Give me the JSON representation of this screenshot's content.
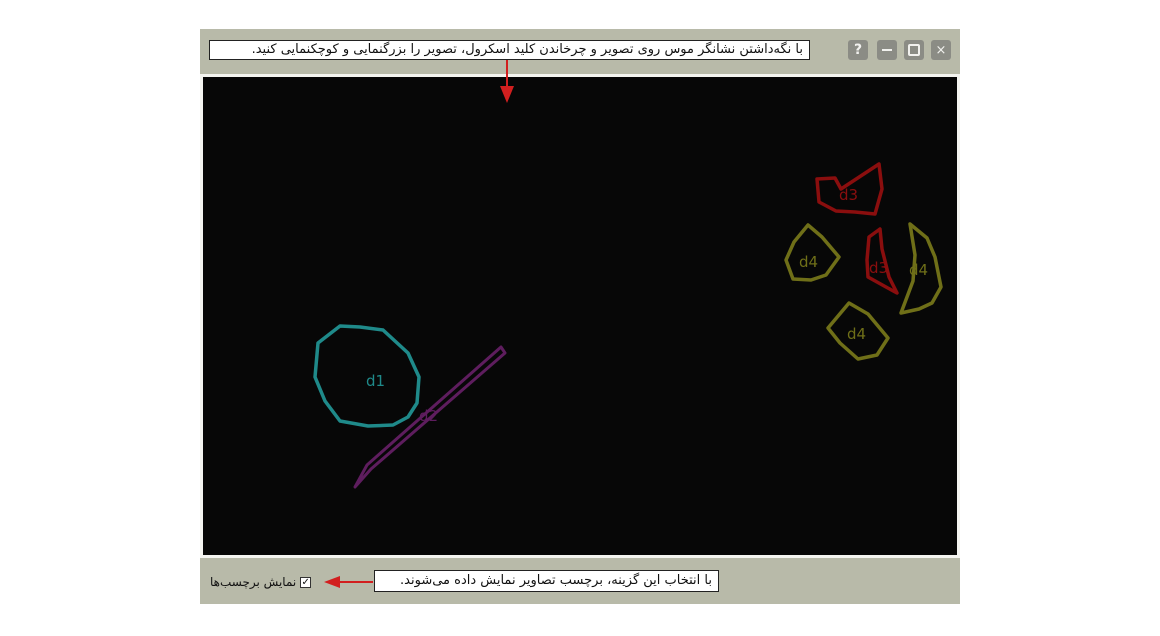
{
  "window": {
    "buttons": {
      "close_glyph": "×",
      "help_glyph": "?"
    },
    "colors": {
      "frame": "#b8baa9",
      "button": "#8b8c85",
      "canvas": "#070707"
    }
  },
  "viewer": {
    "regions": [
      {
        "label": "d1",
        "color": "#1f8a8a"
      },
      {
        "label": "d2",
        "color": "#5e1d5e"
      },
      {
        "label": "d3",
        "color": "#8a0e0e"
      },
      {
        "label": "d3",
        "color": "#8a0e0e"
      },
      {
        "label": "d4",
        "color": "#6f6f18"
      },
      {
        "label": "d4",
        "color": "#6f6f18"
      },
      {
        "label": "d4",
        "color": "#6f6f18"
      }
    ]
  },
  "bottom": {
    "show_labels_text": "نمایش برچسب‌ها",
    "show_labels_checked": true,
    "check_glyph": "✓"
  },
  "callouts": {
    "zoom_hint": "با نگه‌داشتن نشانگر موس روی تصویر و چرخاندن کلید اسکرول، تصویر را بزرگنمایی و کوچکنمایی کنید.",
    "labels_hint": "با انتخاب این گزینه، برچسب تصاویر نمایش داده می‌شوند."
  },
  "icons": [
    "help-icon",
    "minimize-icon",
    "maximize-icon",
    "close-icon",
    "checkbox-icon",
    "arrow-icon"
  ]
}
